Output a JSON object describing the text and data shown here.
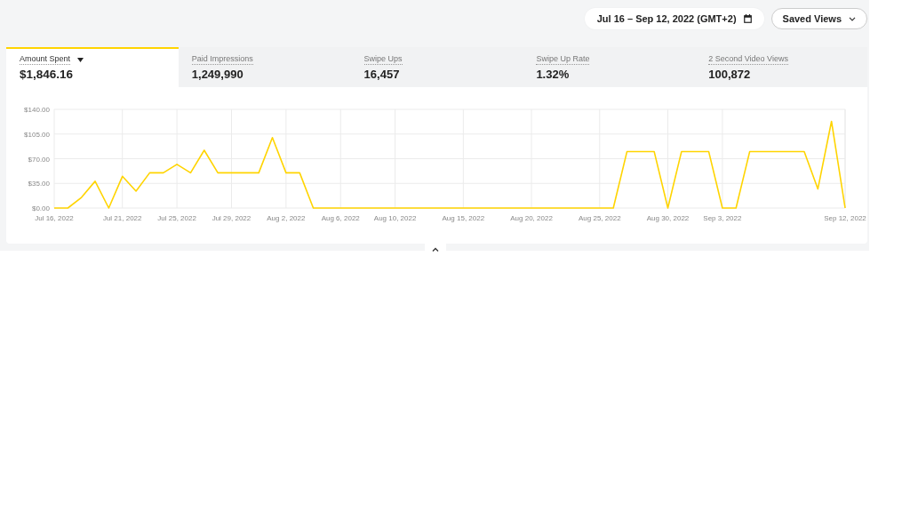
{
  "toolbar": {
    "date_range": "Jul 16 – Sep 12, 2022 (GMT+2)",
    "saved_views": "Saved Views"
  },
  "metric_tabs": [
    {
      "label": "Amount Spent",
      "value": "$1,846.16",
      "selected": true
    },
    {
      "label": "Paid Impressions",
      "value": "1,249,990",
      "selected": false
    },
    {
      "label": "Swipe Ups",
      "value": "16,457",
      "selected": false
    },
    {
      "label": "Swipe Up Rate",
      "value": "1.32%",
      "selected": false
    },
    {
      "label": "2 Second Video Views",
      "value": "100,872",
      "selected": false
    }
  ],
  "chart": {
    "chart_data": {
      "type": "line",
      "categories": [
        "Jul 16, 2022",
        null,
        null,
        null,
        null,
        "Jul 21, 2022",
        null,
        null,
        null,
        "Jul 25, 2022",
        null,
        null,
        null,
        "Jul 29, 2022",
        null,
        null,
        null,
        "Aug 2, 2022",
        null,
        null,
        null,
        "Aug 6, 2022",
        null,
        null,
        null,
        "Aug 10, 2022",
        null,
        null,
        null,
        null,
        "Aug 15, 2022",
        null,
        null,
        null,
        null,
        "Aug 20, 2022",
        null,
        null,
        null,
        null,
        "Aug 25, 2022",
        null,
        null,
        null,
        null,
        "Aug 30, 2022",
        null,
        null,
        null,
        "Sep 3, 2022",
        null,
        null,
        null,
        null,
        null,
        null,
        null,
        null,
        "Sep 12, 2022"
      ],
      "series": [
        {
          "color": "#ffd400",
          "values": [
            0,
            0,
            15,
            38,
            0,
            45,
            24,
            50,
            50,
            62,
            50,
            82,
            50,
            50,
            50,
            50,
            100,
            50,
            50,
            0,
            0,
            0,
            0,
            0,
            0,
            0,
            0,
            0,
            0,
            0,
            0,
            0,
            0,
            0,
            0,
            0,
            0,
            0,
            0,
            0,
            0,
            0,
            80,
            80,
            80,
            0,
            80,
            80,
            80,
            0,
            0,
            80,
            80,
            80,
            80,
            80,
            27,
            123,
            0
          ]
        }
      ],
      "ylim": [
        0,
        140
      ],
      "grid": true,
      "yticks": [
        {
          "value": 0,
          "label": "$0.00"
        },
        {
          "value": 35,
          "label": "$35.00"
        },
        {
          "value": 70,
          "label": "$70.00"
        },
        {
          "value": 105,
          "label": "$105.00"
        },
        {
          "value": 140,
          "label": "$140.00"
        }
      ]
    }
  }
}
